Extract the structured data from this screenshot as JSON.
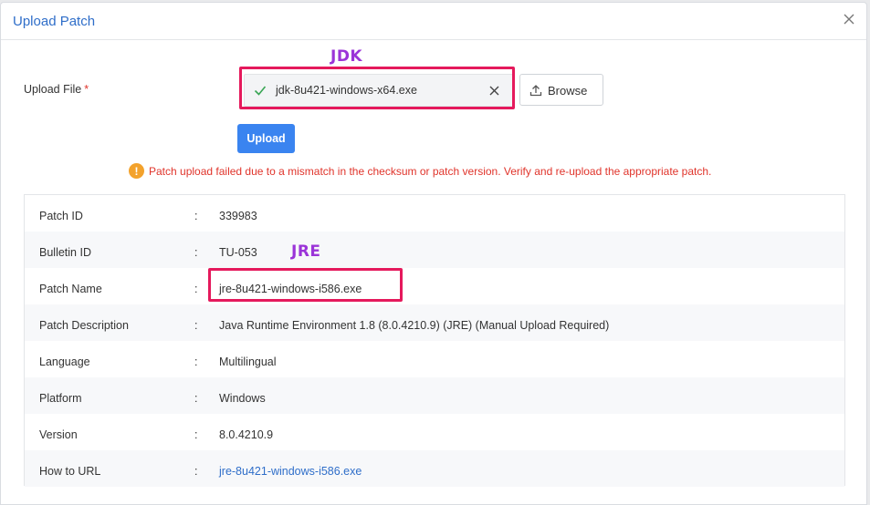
{
  "dialog": {
    "title": "Upload Patch"
  },
  "upload_file": {
    "label": "Upload File",
    "required_mark": "*",
    "selected_file": "jdk-8u421-windows-x64.exe",
    "browse_label": "Browse",
    "upload_label": "Upload"
  },
  "annotations": {
    "jdk_label": "JDK",
    "jre_label": "JRE",
    "color": "#e5195c",
    "text_color": "#9b34d8"
  },
  "error_message": "Patch upload failed due to a mismatch in the checksum or patch version. Verify and re-upload the appropriate patch.",
  "details": [
    {
      "key": "Patch ID",
      "sep": ":",
      "value": "339983"
    },
    {
      "key": "Bulletin ID",
      "sep": ":",
      "value": "TU-053"
    },
    {
      "key": "Patch Name",
      "sep": ":",
      "value": "jre-8u421-windows-i586.exe"
    },
    {
      "key": "Patch Description",
      "sep": ":",
      "value": "Java Runtime Environment 1.8 (8.0.4210.9) (JRE) (Manual Upload Required)"
    },
    {
      "key": "Language",
      "sep": ":",
      "value": "Multilingual"
    },
    {
      "key": "Platform",
      "sep": ":",
      "value": "Windows"
    },
    {
      "key": "Version",
      "sep": ":",
      "value": "8.0.4210.9"
    },
    {
      "key": "How to URL",
      "sep": ":",
      "value": "jre-8u421-windows-i586.exe"
    }
  ],
  "colors": {
    "accent": "#2f6ec9",
    "primary_button": "#3a84f0",
    "error": "#e0342b",
    "warning": "#f3a22c"
  }
}
